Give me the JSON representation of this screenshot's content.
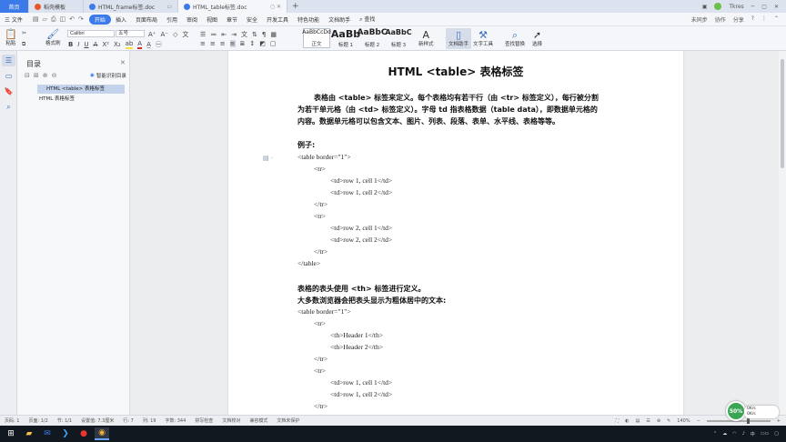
{
  "tabs": {
    "home": "首页",
    "items": [
      {
        "label": "稻壳模板",
        "color": "#e8562a"
      },
      {
        "label": "HTML_frame标签.doc",
        "color": "#3b7ae8"
      },
      {
        "label": "HTML_table标签.doc",
        "color": "#3b7ae8"
      }
    ],
    "user": "Tkres"
  },
  "menu": {
    "file": "三 文件",
    "items": [
      "开始",
      "插入",
      "页面布局",
      "引用",
      "审阅",
      "视图",
      "章节",
      "安全",
      "开发工具",
      "特色功能",
      "文档助手"
    ],
    "active_index": 0,
    "search": "查找",
    "right": [
      "未同步",
      "协作",
      "分享"
    ]
  },
  "ribbon": {
    "paste": "粘贴",
    "format_painter": "格式刷",
    "font_name": "Calibri",
    "font_size": "五号",
    "styles": [
      {
        "preview": "AaBbCcDd",
        "label": "正文"
      },
      {
        "preview": "AaBb",
        "label": "标题 1"
      },
      {
        "preview": "AaBbC",
        "label": "标题 2"
      },
      {
        "preview": "AaBbC",
        "label": "标题 3"
      }
    ],
    "new_style": "新样式",
    "doc_helper": "文档助手",
    "text_tools": "文字工具",
    "find_replace": "查找替换",
    "select": "选择"
  },
  "toc": {
    "title": "目录",
    "smart": "智能识别目录",
    "items": [
      "HTML <table> 表格标签",
      "HTML 表格标签"
    ]
  },
  "document": {
    "title": "HTML <table>  表格标签",
    "intro": [
      "表格由 <table> 标签来定义。每个表格均有若干行（由 <tr> 标签定义），每行被分割",
      "为若干单元格（由 <td> 标签定义）。字母 td 指表格数据（table data），即数据单元格的",
      "内容。数据单元格可以包含文本、图片、列表、段落、表单、水平线、表格等等。"
    ],
    "example": "例子:",
    "code1": [
      "<table border=\"1\">",
      "<tr>",
      "<td>row 1, cell 1</td>",
      "<td>row 1, cell 2</td>",
      "</tr>",
      "<tr>",
      "<td>row 2, cell 1</td>",
      "<td>row 2, cell 2</td>",
      "</tr>",
      "</table>"
    ],
    "header_text1": "表格的表头使用 <th> 标签进行定义。",
    "header_text2": "大多数浏览器会把表头显示为粗体居中的文本:",
    "code2": [
      "<table border=\"1\">",
      "<tr>",
      "<th>Header 1</th>",
      "<th>Header 2</th>",
      "</tr>",
      "<tr>",
      "<td>row 1, cell 1</td>",
      "<td>row 1, cell 2</td>",
      "</tr>"
    ]
  },
  "status": {
    "page": "页码: 1",
    "pages": "页面: 1/2",
    "section": "节: 1/1",
    "setting": "设置值: 7.3厘米",
    "row": "行: 7",
    "col": "列: 19",
    "words": "字数: 344",
    "spell": "拼写检查",
    "proof": "文档校对",
    "compat": "兼容模式",
    "protect": "文档未保护",
    "zoom": "140%"
  },
  "widget": {
    "pct": "50%",
    "up": "0K/s",
    "down": "0K/s"
  }
}
